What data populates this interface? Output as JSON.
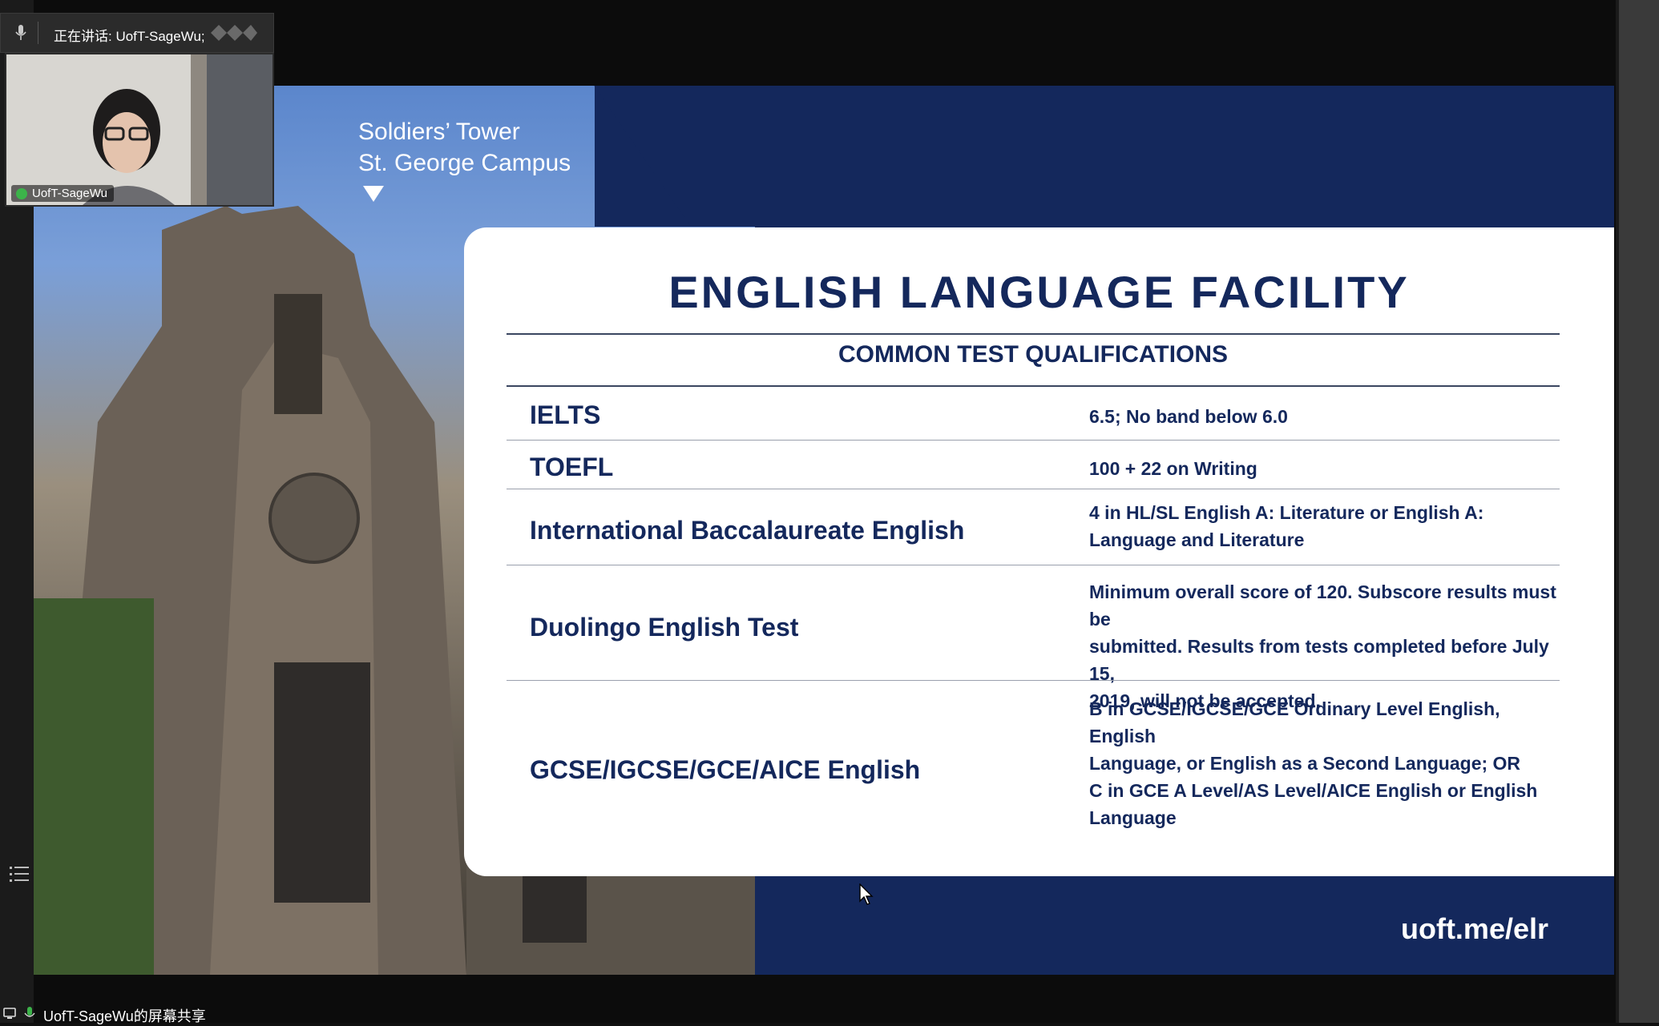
{
  "meeting": {
    "speaking_label": "正在讲话: UofT-SageWu;",
    "participant_name": "UofT-SageWu",
    "share_label": "UofT-SageWu的屏幕共享"
  },
  "slide": {
    "caption_line1": "Soldiers’ Tower",
    "caption_line2": "St. George Campus",
    "title": "ENGLISH LANGUAGE FACILITY",
    "subtitle": "COMMON TEST QUALIFICATIONS",
    "rows": [
      {
        "label": "IELTS",
        "value_lines": [
          "6.5; No band below 6.0"
        ]
      },
      {
        "label": "TOEFL",
        "value_lines": [
          "100 + 22 on Writing"
        ]
      },
      {
        "label": "International Baccalaureate English",
        "value_lines": [
          "4 in HL/SL English A: Literature or English A:",
          "Language and Literature"
        ]
      },
      {
        "label": "Duolingo English Test",
        "value_lines": [
          "Minimum overall score of 120. Subscore results must be",
          "submitted. Results from tests completed before July 15,",
          "2019, will not be accepted."
        ]
      },
      {
        "label": "GCSE/IGCSE/GCE/AICE English",
        "value_lines": [
          "B in GCSE/IGCSE/GCE Ordinary Level English, English",
          "Language, or English as a Second Language; OR",
          "C in GCE A Level/AS Level/AICE English or English",
          "Language"
        ]
      }
    ],
    "url": "uoft.me/elr"
  },
  "colors": {
    "navy": "#14285c",
    "speaking_dot": "#3cb34a"
  }
}
